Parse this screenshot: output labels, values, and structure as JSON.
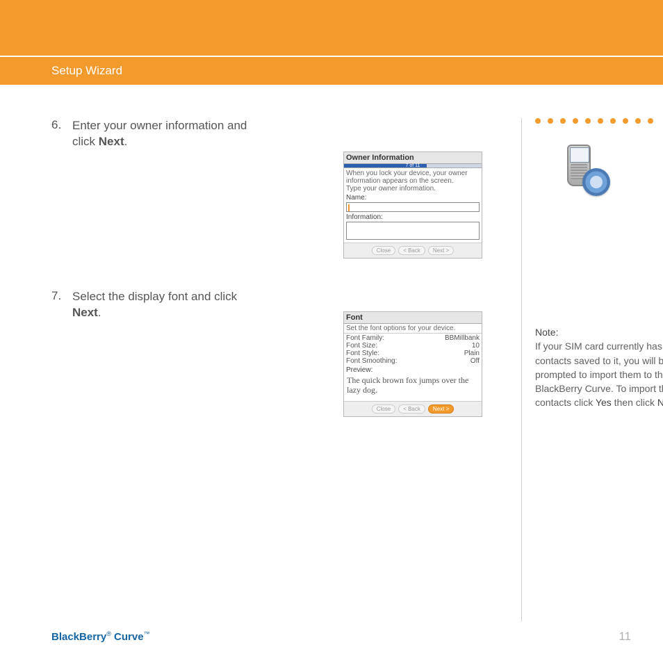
{
  "header": {
    "section": "Setup Wizard"
  },
  "steps": [
    {
      "num": "6.",
      "text_a": "Enter your owner information and click ",
      "bold": "Next",
      "text_b": "."
    },
    {
      "num": "7.",
      "text_a": "Select the display font and click ",
      "bold": "Next",
      "text_b": "."
    }
  ],
  "shot1": {
    "title": "Owner Information",
    "progress": "7 of 11",
    "msg": "When you lock your device, your owner information appears on the screen.",
    "prompt": "Type your owner information.",
    "name_label": "Name:",
    "info_label": "Information:",
    "btn_close": "Close",
    "btn_back": "< Back",
    "btn_next": "Next >"
  },
  "shot2": {
    "title": "Font",
    "msg": "Set the font options for your device.",
    "rows": [
      {
        "k": "Font Family:",
        "v": "BBMillbank"
      },
      {
        "k": "Font Size:",
        "v": "10"
      },
      {
        "k": "Font Style:",
        "v": "Plain"
      },
      {
        "k": "Font Smoothing:",
        "v": "Off"
      }
    ],
    "preview_label": "Preview:",
    "preview_text": "The quick brown fox jumps over the lazy dog.",
    "btn_close": "Close",
    "btn_back": "< Back",
    "btn_next": "Next >"
  },
  "sidebar": {
    "note_label": "Note:",
    "note_a": "If your SIM card currently has contacts saved to it, you will be prompted to import them to the BlackBerry Curve. To import the contacts click ",
    "note_yes": "Yes",
    "note_b": " then click ",
    "note_next": "Next",
    "note_c": "."
  },
  "footer": {
    "brand_a": "BlackBerry",
    "reg": "®",
    "brand_b": " Curve",
    "tm": "™",
    "page": "11"
  }
}
